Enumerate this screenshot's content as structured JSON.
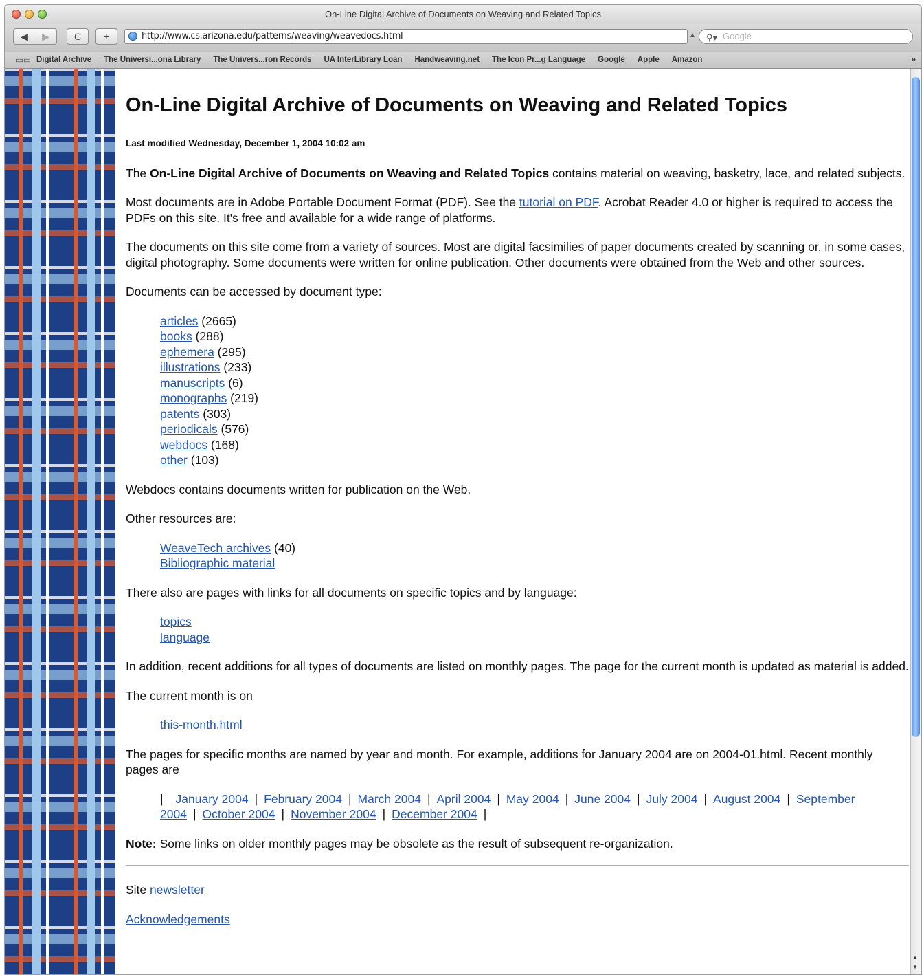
{
  "window": {
    "title": "On-Line Digital Archive of Documents on Weaving and Related Topics"
  },
  "toolbar": {
    "back": "◀",
    "forward": "▶",
    "reload": "C",
    "add": "+",
    "url": "http://www.cs.arizona.edu/patterns/weaving/weavedocs.html",
    "search_placeholder": "Google"
  },
  "bookmarks": [
    "Digital Archive",
    "The Universi...ona Library",
    "The Univers...ron Records",
    "UA InterLibrary Loan",
    "Handweaving.net",
    "The Icon Pr...g Language",
    "Google",
    "Apple",
    "Amazon"
  ],
  "bookmarks_more": "»",
  "page": {
    "title": "On-Line Digital Archive of Documents on Weaving and Related Topics",
    "modified": "Last modified Wednesday, December 1, 2004 10:02 am",
    "intro_prefix": "The ",
    "intro_bold": "On-Line Digital Archive of Documents on Weaving and Related Topics",
    "intro_suffix": " contains material on weaving, basketry, lace, and related subjects.",
    "pdf_prefix": "Most documents are in Adobe Portable Document Format (PDF). See the ",
    "pdf_link": "tutorial on PDF",
    "pdf_suffix": ". Acrobat Reader 4.0 or higher is required to access the PDFs on this site. It's free and available for a wide range of platforms.",
    "sources": "The documents on this site come from a variety of sources. Most are digital facsimilies of paper documents created by scanning or, in some cases, digital photography. Some documents were written for online publication. Other documents were obtained from the Web and other sources.",
    "access_by_type": "Documents can be accessed by document type:",
    "doc_types": [
      {
        "label": "articles",
        "count": " (2665)"
      },
      {
        "label": "books",
        "count": " (288)"
      },
      {
        "label": "ephemera",
        "count": " (295)"
      },
      {
        "label": "illustrations",
        "count": " (233)"
      },
      {
        "label": "manuscripts",
        "count": " (6)"
      },
      {
        "label": "monographs",
        "count": " (219)"
      },
      {
        "label": "patents",
        "count": " (303)"
      },
      {
        "label": "periodicals",
        "count": " (576)"
      },
      {
        "label": "webdocs",
        "count": " (168)"
      },
      {
        "label": "other",
        "count": " (103)"
      }
    ],
    "webdocs_note": "Webdocs contains documents written for publication on the Web.",
    "other_resources": "Other resources are:",
    "resources": [
      {
        "label": "WeaveTech archives",
        "count": " (40)"
      },
      {
        "label": "Bibliographic material",
        "count": ""
      }
    ],
    "topics_intro": "There also are pages with links for all documents on specific topics and by language:",
    "topic_links": [
      "topics",
      "language"
    ],
    "monthly_intro": "In addition, recent additions for all types of documents are listed on monthly pages. The page for the current month is updated as material is added.",
    "current_month_text": "The current month is on",
    "current_month_link": "this-month.html",
    "specific_months": "The pages for specific months are named by year and month. For example, additions for January 2004 are on 2004-01.html. Recent monthly pages are",
    "months": [
      "January 2004",
      "February 2004",
      "March 2004",
      "April 2004",
      "May 2004",
      "June 2004",
      "July 2004",
      "August 2004",
      "September 2004",
      "October 2004",
      "November 2004",
      "December 2004"
    ],
    "month_separator": "|",
    "note_label": "Note:",
    "note_text": " Some links on older monthly pages may be obsolete as the result of subsequent re-organization.",
    "site_prefix": "Site ",
    "newsletter_link": "newsletter",
    "acknowledgements_link": "Acknowledgements"
  }
}
